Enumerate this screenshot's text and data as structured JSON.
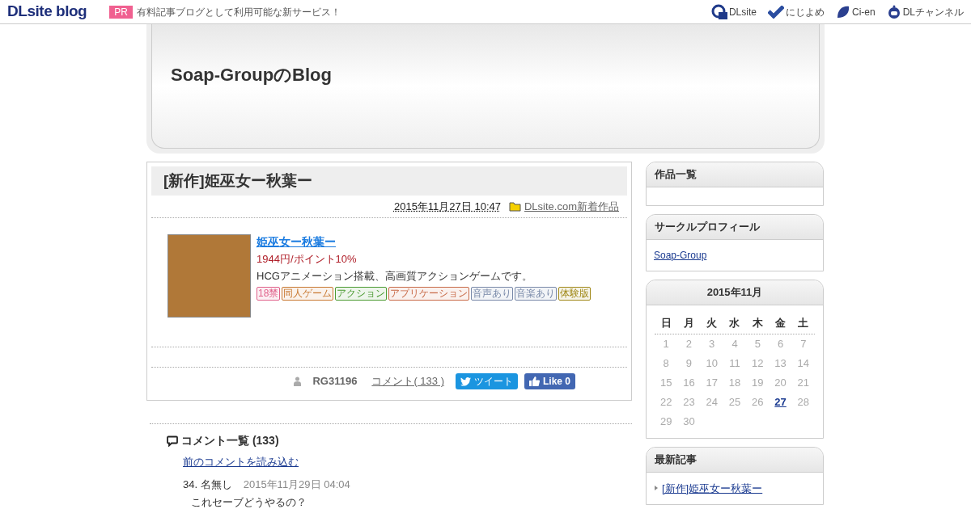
{
  "topbar": {
    "logo": "DLsite blog",
    "pr_badge": "PR",
    "pr_text": "有料記事ブログとして利用可能な新サービス！",
    "links": [
      {
        "label": "DLsite"
      },
      {
        "label": "にじよめ"
      },
      {
        "label": "Ci-en"
      },
      {
        "label": "DLチャンネル"
      }
    ]
  },
  "header": {
    "title": "Soap-GroupのBlog"
  },
  "article": {
    "title": "[新作]姫巫女ー秋葉ー",
    "date": "2015年11月27日 10:47",
    "category": "DLsite.com新着作品",
    "product": {
      "name": "姫巫女ー秋葉ー",
      "price": "1944円/ポイント10%",
      "description": "HCGアニメーション搭載、高画質アクションゲームです。",
      "tags": [
        {
          "label": "18禁",
          "color": "#e0608a"
        },
        {
          "label": "同人ゲーム",
          "color": "#c87830"
        },
        {
          "label": "アクション",
          "color": "#4a9a30"
        },
        {
          "label": "アプリケーション",
          "color": "#c86a48"
        },
        {
          "label": "音声あり",
          "color": "#7888a8"
        },
        {
          "label": "音楽あり",
          "color": "#7888a8"
        },
        {
          "label": "体験版",
          "color": "#a08818"
        }
      ]
    },
    "author": "RG31196",
    "comments_link": "コメント( 133 )",
    "tweet_button": "ツイート",
    "like_button": "Like 0"
  },
  "comments": {
    "heading": "コメント一覧 (133)",
    "load_previous": "前のコメントを読み込む",
    "items": [
      {
        "number": "34.",
        "name": "名無し",
        "date": "2015年11月29日 04:04",
        "body": "これセーブどうやるの？"
      }
    ]
  },
  "sidebar": {
    "works": {
      "title": "作品一覧"
    },
    "profile": {
      "title": "サークルプロフィール",
      "link": "Soap-Group"
    },
    "calendar": {
      "title": "2015年11月",
      "weekdays": [
        "日",
        "月",
        "火",
        "水",
        "木",
        "金",
        "土"
      ],
      "weeks": [
        [
          {
            "day": "1",
            "linked": false
          },
          {
            "day": "2",
            "linked": false
          },
          {
            "day": "3",
            "linked": false
          },
          {
            "day": "4",
            "linked": false
          },
          {
            "day": "5",
            "linked": false
          },
          {
            "day": "6",
            "linked": false
          },
          {
            "day": "7",
            "linked": false
          }
        ],
        [
          {
            "day": "8",
            "linked": false
          },
          {
            "day": "9",
            "linked": false
          },
          {
            "day": "10",
            "linked": false
          },
          {
            "day": "11",
            "linked": false
          },
          {
            "day": "12",
            "linked": false
          },
          {
            "day": "13",
            "linked": false
          },
          {
            "day": "14",
            "linked": false
          }
        ],
        [
          {
            "day": "15",
            "linked": false
          },
          {
            "day": "16",
            "linked": false
          },
          {
            "day": "17",
            "linked": false
          },
          {
            "day": "18",
            "linked": false
          },
          {
            "day": "19",
            "linked": false
          },
          {
            "day": "20",
            "linked": false
          },
          {
            "day": "21",
            "linked": false
          }
        ],
        [
          {
            "day": "22",
            "linked": false
          },
          {
            "day": "23",
            "linked": false
          },
          {
            "day": "24",
            "linked": false
          },
          {
            "day": "25",
            "linked": false
          },
          {
            "day": "26",
            "linked": false
          },
          {
            "day": "27",
            "linked": true
          },
          {
            "day": "28",
            "linked": false
          }
        ],
        [
          {
            "day": "29",
            "linked": false
          },
          {
            "day": "30",
            "linked": false
          }
        ]
      ]
    },
    "recent": {
      "title": "最新記事",
      "items": [
        "[新作]姫巫女ー秋葉ー"
      ]
    }
  }
}
